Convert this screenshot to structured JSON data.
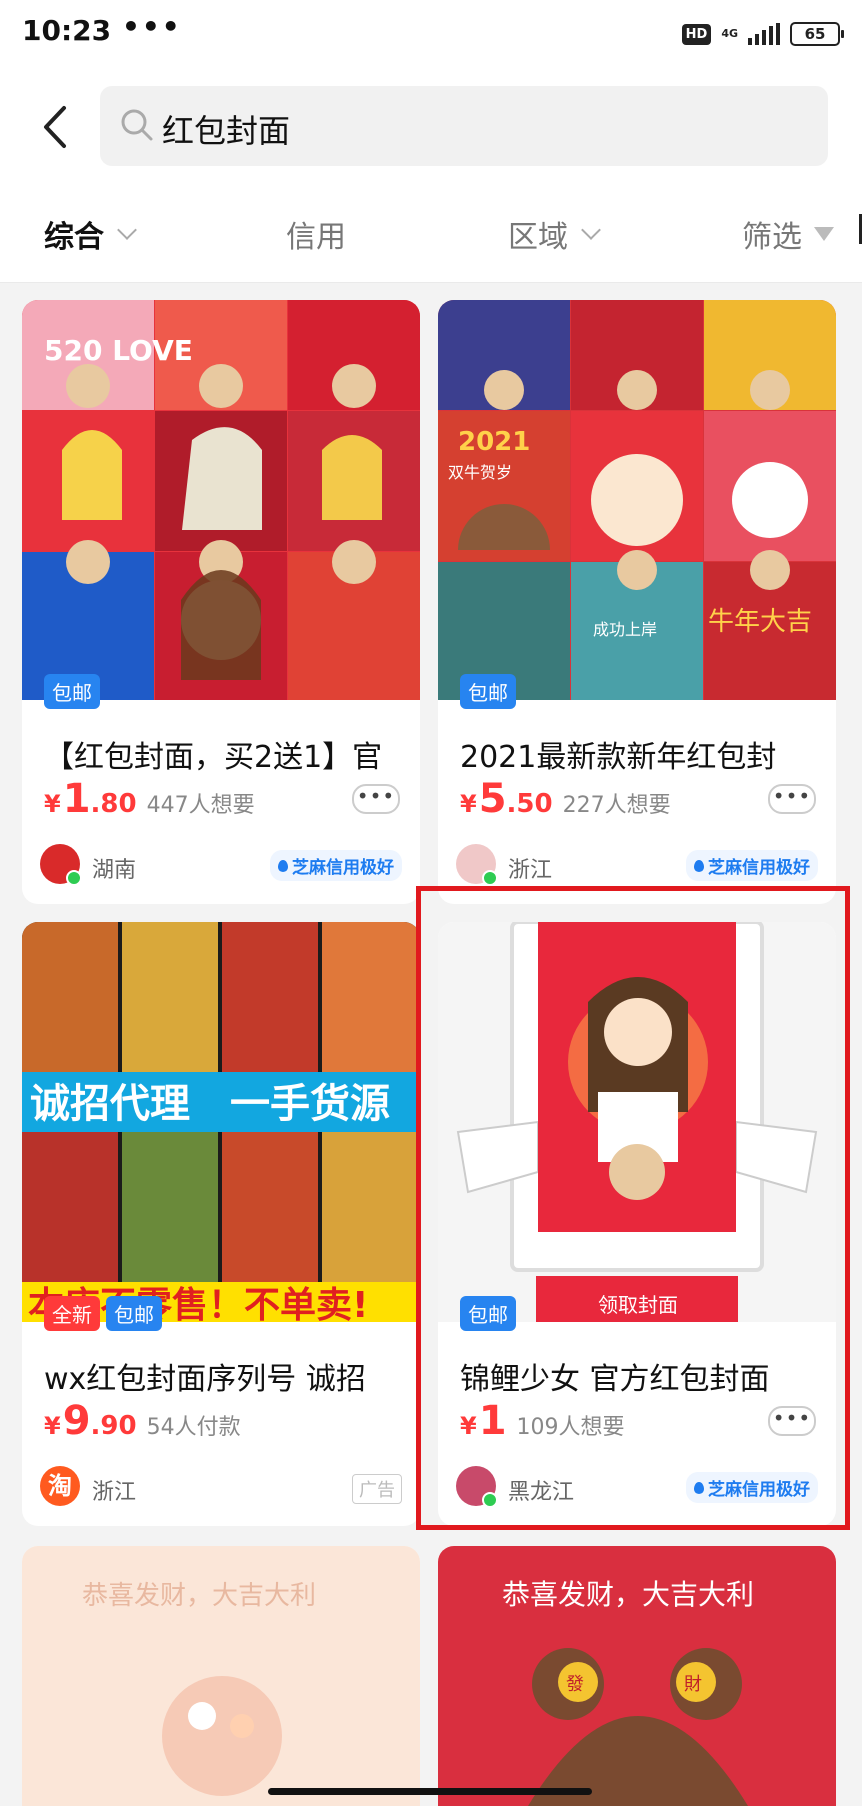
{
  "status_bar": {
    "time": "10:23",
    "dots": "•••",
    "hd": "HD",
    "network": "4G",
    "battery": "65"
  },
  "search": {
    "query": "红包封面"
  },
  "filters": [
    {
      "label": "综合",
      "active": true,
      "dropdown": true
    },
    {
      "label": "信用"
    },
    {
      "label": "区域",
      "dropdown": true
    },
    {
      "label": "筛选",
      "icon": "filter-icon"
    }
  ],
  "products": [
    {
      "tags": [
        "包邮"
      ],
      "title": "【红包封面，买2送1】官",
      "price_symbol": "¥",
      "price_int": "1",
      "price_dec": ".80",
      "interest": "447人想要",
      "more": "•••",
      "region": "湖南",
      "credit": "芝麻信用极好"
    },
    {
      "tags": [
        "包邮"
      ],
      "title": "2021最新款新年红包封",
      "price_symbol": "¥",
      "price_int": "5",
      "price_dec": ".50",
      "interest": "227人想要",
      "more": "•••",
      "region": "浙江",
      "credit": "芝麻信用极好"
    },
    {
      "tags": [
        "全新",
        "包邮"
      ],
      "title": "wx红包封面序列号 诚招",
      "price_symbol": "¥",
      "price_int": "9",
      "price_dec": ".90",
      "interest": "54人付款",
      "region": "浙江",
      "ad": "广告",
      "shop_logo": "淘",
      "banner": "诚招代理　一手货源",
      "banner2": "本店不零售！不单卖!"
    },
    {
      "tags": [
        "包邮"
      ],
      "title": "锦鲤少女 官方红包封面",
      "price_symbol": "¥",
      "price_int": "1",
      "price_dec": "",
      "interest": "109人想要",
      "more": "•••",
      "region": "黑龙江",
      "credit": "芝麻信用极好",
      "claim_button": "领取封面"
    },
    {
      "image_text": "恭喜发财，大吉大利"
    },
    {
      "image_text": "恭喜发财，大吉大利",
      "ears": [
        "發",
        "財"
      ]
    }
  ],
  "image_texts": {
    "p1_love": "520 LOVE",
    "p2_year": "2021",
    "p2_caption": "双牛贺岁",
    "p2_shout": "牛年大吉",
    "p2_sub": "成功上岸"
  },
  "colors": {
    "price": "#ff3a3a",
    "tag_blue": "#2784f0",
    "credit_blue": "#1e7cf0",
    "highlight": "#e1191e"
  }
}
